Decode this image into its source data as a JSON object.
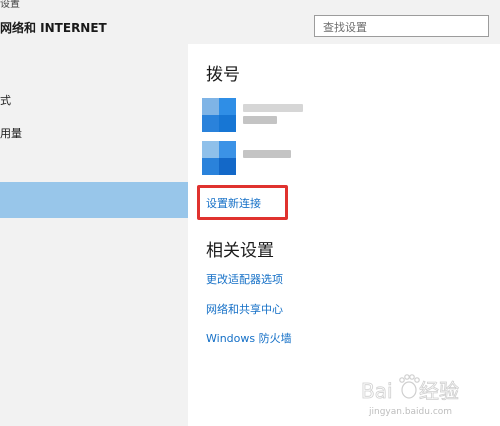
{
  "header": {
    "top_text": "设置",
    "title": "网络和 INTERNET",
    "search_placeholder": "查找设置"
  },
  "sidebar": {
    "items": [
      {
        "label": "式"
      },
      {
        "label": "用量"
      }
    ]
  },
  "main": {
    "dialup_title": "拨号",
    "new_connection_link": "设置新连接",
    "related_title": "相关设置",
    "related_links": [
      "更改适配器选项",
      "网络和共享中心",
      "Windows 防火墙"
    ]
  },
  "watermark": {
    "brand": "Baidu经验",
    "url": "jingyan.baidu.com"
  },
  "colors": {
    "link": "#1570c7",
    "selected": "#98c6ea",
    "highlight_border": "#e0322f",
    "icon_blue": "#2a8ee8"
  },
  "icons": [
    "connection-icon",
    "connection-icon"
  ]
}
